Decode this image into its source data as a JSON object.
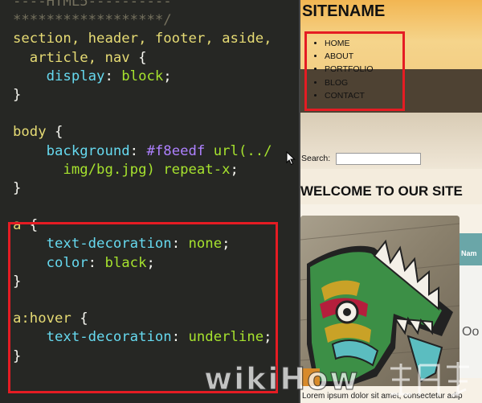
{
  "editor": {
    "lines": [
      [
        {
          "t": "----HTML5----------",
          "c": "cm"
        }
      ],
      [
        {
          "t": "******************/",
          "c": "cm"
        }
      ],
      [
        {
          "t": "section, header, footer, aside,",
          "c": "sel"
        }
      ],
      [
        {
          "t": "  article, nav",
          "c": "sel"
        },
        {
          "t": " {",
          "c": "pl"
        }
      ],
      [
        {
          "t": "    display",
          "c": "prop"
        },
        {
          "t": ": ",
          "c": "pl"
        },
        {
          "t": "block",
          "c": "val"
        },
        {
          "t": ";",
          "c": "pl"
        }
      ],
      [
        {
          "t": "}",
          "c": "pl"
        }
      ],
      [
        {
          "t": "",
          "c": "pl"
        }
      ],
      [
        {
          "t": "body",
          "c": "sel"
        },
        {
          "t": " {",
          "c": "pl"
        }
      ],
      [
        {
          "t": "    background",
          "c": "prop"
        },
        {
          "t": ": ",
          "c": "pl"
        },
        {
          "t": "#f8eedf",
          "c": "hex"
        },
        {
          "t": " url(../",
          "c": "val"
        }
      ],
      [
        {
          "t": "      img/bg.jpg) repeat-x",
          "c": "val"
        },
        {
          "t": ";",
          "c": "pl"
        }
      ],
      [
        {
          "t": "}",
          "c": "pl"
        }
      ],
      [
        {
          "t": "",
          "c": "pl"
        }
      ],
      [
        {
          "t": "a",
          "c": "sel"
        },
        {
          "t": " {",
          "c": "pl"
        }
      ],
      [
        {
          "t": "    text-decoration",
          "c": "prop"
        },
        {
          "t": ": ",
          "c": "pl"
        },
        {
          "t": "none",
          "c": "val"
        },
        {
          "t": ";",
          "c": "pl"
        }
      ],
      [
        {
          "t": "    color",
          "c": "prop"
        },
        {
          "t": ": ",
          "c": "pl"
        },
        {
          "t": "black",
          "c": "val"
        },
        {
          "t": ";",
          "c": "pl"
        }
      ],
      [
        {
          "t": "}",
          "c": "pl"
        }
      ],
      [
        {
          "t": "",
          "c": "pl"
        }
      ],
      [
        {
          "t": "a:hover",
          "c": "sel"
        },
        {
          "t": " {",
          "c": "pl"
        }
      ],
      [
        {
          "t": "    text-decoration",
          "c": "prop"
        },
        {
          "t": ": ",
          "c": "pl"
        },
        {
          "t": "underline",
          "c": "val"
        },
        {
          "t": ";",
          "c": "pl"
        }
      ],
      [
        {
          "t": "}",
          "c": "pl"
        }
      ]
    ]
  },
  "preview": {
    "site_title": "SITENAME",
    "nav_items": [
      "HOME",
      "ABOUT",
      "PORTFOLIO",
      "BLOG",
      "CONTACT"
    ],
    "search_label": "Search:",
    "search_value": "",
    "welcome_heading": "WELCOME TO OUR SITE",
    "side_panel_label": "Nam",
    "side_panel_text": "Oo",
    "lorem_text": "Lorem ipsum dolor sit amet, consectetur adip"
  },
  "colors": {
    "highlight_box": "#e51c23",
    "editor_bg": "#262724",
    "header_gold": "#f2b652",
    "nav_band": "#4e4233",
    "teal": "#6aa6a8"
  },
  "icons": {
    "mouse_cursor": "cursor-icon",
    "watermark_logo": "wikihow-watermark"
  },
  "watermark_text": "wikiHow"
}
